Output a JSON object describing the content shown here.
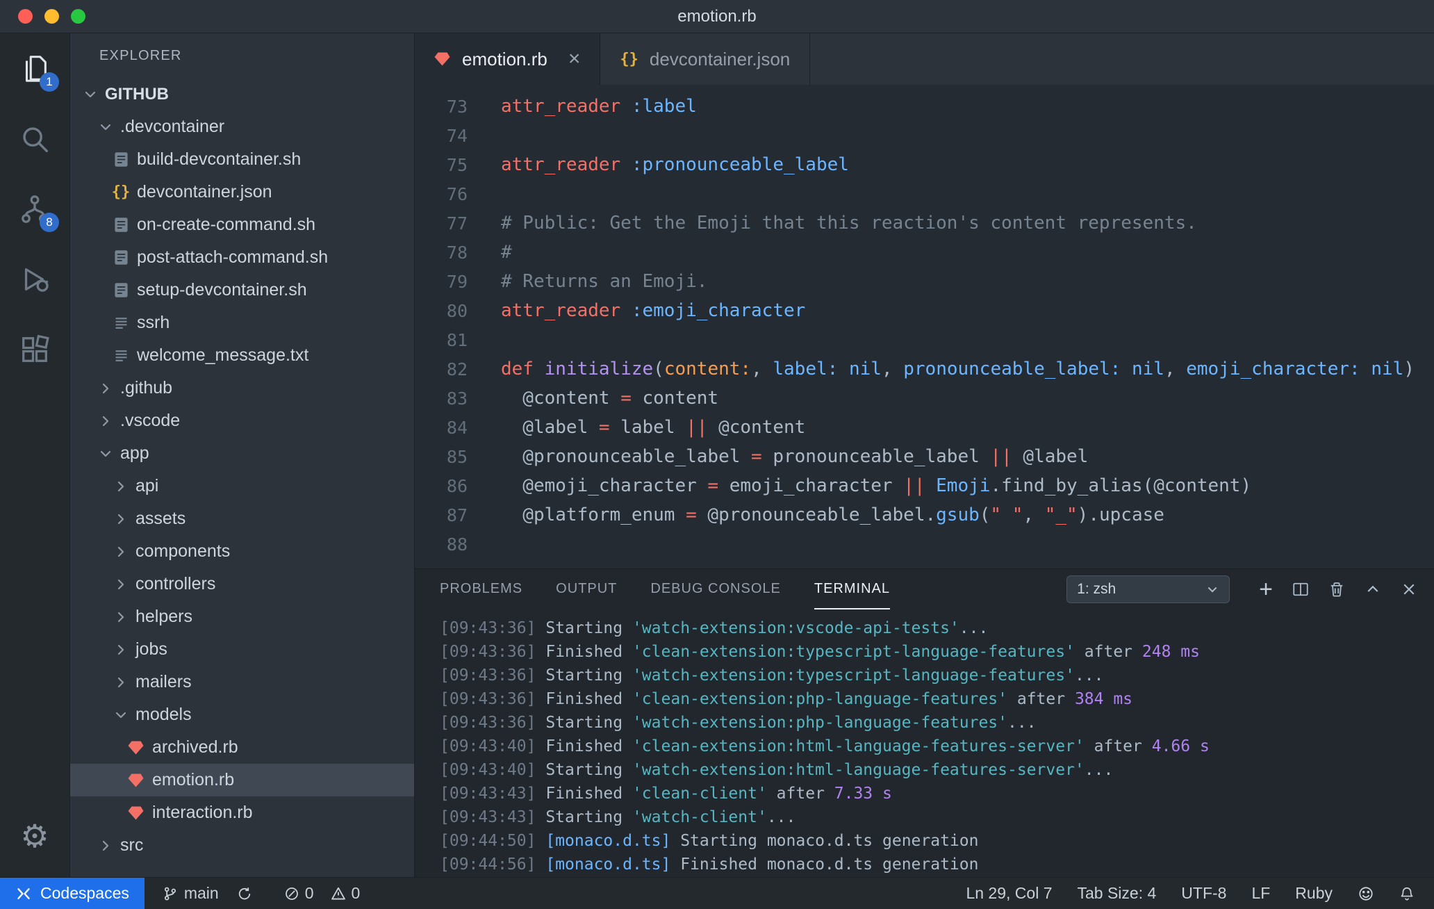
{
  "window": {
    "title": "emotion.rb"
  },
  "activity_bar": {
    "explorer_badge": "1",
    "scm_badge": "8"
  },
  "sidebar": {
    "header": "EXPLORER",
    "tree": [
      {
        "label": "GITHUB",
        "type": "root",
        "level": 0,
        "expanded": true
      },
      {
        "label": ".devcontainer",
        "type": "folder",
        "level": 1,
        "expanded": true
      },
      {
        "label": "build-devcontainer.sh",
        "type": "file",
        "icon": "sh",
        "level": 2
      },
      {
        "label": "devcontainer.json",
        "type": "file",
        "icon": "json",
        "level": 2
      },
      {
        "label": "on-create-command.sh",
        "type": "file",
        "icon": "sh",
        "level": 2
      },
      {
        "label": "post-attach-command.sh",
        "type": "file",
        "icon": "sh",
        "level": 2
      },
      {
        "label": "setup-devcontainer.sh",
        "type": "file",
        "icon": "sh",
        "level": 2
      },
      {
        "label": "ssrh",
        "type": "file",
        "icon": "txt",
        "level": 2
      },
      {
        "label": "welcome_message.txt",
        "type": "file",
        "icon": "txt",
        "level": 2
      },
      {
        "label": ".github",
        "type": "folder",
        "level": 1,
        "expanded": false
      },
      {
        "label": ".vscode",
        "type": "folder",
        "level": 1,
        "expanded": false
      },
      {
        "label": "app",
        "type": "folder",
        "level": 1,
        "expanded": true
      },
      {
        "label": "api",
        "type": "folder",
        "level": 2,
        "expanded": false
      },
      {
        "label": "assets",
        "type": "folder",
        "level": 2,
        "expanded": false
      },
      {
        "label": "components",
        "type": "folder",
        "level": 2,
        "expanded": false
      },
      {
        "label": "controllers",
        "type": "folder",
        "level": 2,
        "expanded": false
      },
      {
        "label": "helpers",
        "type": "folder",
        "level": 2,
        "expanded": false
      },
      {
        "label": "jobs",
        "type": "folder",
        "level": 2,
        "expanded": false
      },
      {
        "label": "mailers",
        "type": "folder",
        "level": 2,
        "expanded": false
      },
      {
        "label": "models",
        "type": "folder",
        "level": 2,
        "expanded": true
      },
      {
        "label": "archived.rb",
        "type": "file",
        "icon": "ruby",
        "level": 3
      },
      {
        "label": "emotion.rb",
        "type": "file",
        "icon": "ruby",
        "level": 3,
        "selected": true
      },
      {
        "label": "interaction.rb",
        "type": "file",
        "icon": "ruby",
        "level": 3
      },
      {
        "label": "src",
        "type": "folder",
        "level": 1,
        "expanded": false
      }
    ]
  },
  "editor_tabs": [
    {
      "label": "emotion.rb",
      "icon": "ruby",
      "active": true
    },
    {
      "label": "devcontainer.json",
      "icon": "json",
      "active": false
    }
  ],
  "editor": {
    "lines": [
      {
        "n": "73",
        "tokens": [
          [
            "attr_reader",
            "r"
          ],
          [
            " ",
            "f"
          ],
          [
            ":label",
            "b"
          ]
        ]
      },
      {
        "n": "74",
        "tokens": []
      },
      {
        "n": "75",
        "tokens": [
          [
            "attr_reader",
            "r"
          ],
          [
            " ",
            "f"
          ],
          [
            ":pronounceable_label",
            "b"
          ]
        ]
      },
      {
        "n": "76",
        "tokens": []
      },
      {
        "n": "77",
        "tokens": [
          [
            "# Public: Get the Emoji that this reaction's content represents.",
            "g"
          ]
        ]
      },
      {
        "n": "78",
        "tokens": [
          [
            "#",
            "g"
          ]
        ]
      },
      {
        "n": "79",
        "tokens": [
          [
            "# Returns an Emoji.",
            "g"
          ]
        ]
      },
      {
        "n": "80",
        "tokens": [
          [
            "attr_reader",
            "r"
          ],
          [
            " ",
            "f"
          ],
          [
            ":emoji_character",
            "b"
          ]
        ]
      },
      {
        "n": "81",
        "tokens": []
      },
      {
        "n": "82",
        "tokens": [
          [
            "def",
            "r"
          ],
          [
            " ",
            "f"
          ],
          [
            "initialize",
            "p"
          ],
          [
            "(",
            "f"
          ],
          [
            "content:",
            "o"
          ],
          [
            ", ",
            "f"
          ],
          [
            "label:",
            "b"
          ],
          [
            " ",
            "f"
          ],
          [
            "nil",
            "b"
          ],
          [
            ", ",
            "f"
          ],
          [
            "pronounceable_label:",
            "b"
          ],
          [
            " ",
            "f"
          ],
          [
            "nil",
            "b"
          ],
          [
            ", ",
            "f"
          ],
          [
            "emoji_character:",
            "b"
          ],
          [
            " ",
            "f"
          ],
          [
            "nil",
            "b"
          ],
          [
            ")",
            "f"
          ]
        ]
      },
      {
        "n": "83",
        "tokens": [
          [
            "  @content ",
            "f"
          ],
          [
            "=",
            "r"
          ],
          [
            " content",
            "f"
          ]
        ]
      },
      {
        "n": "84",
        "tokens": [
          [
            "  @label ",
            "f"
          ],
          [
            "=",
            "r"
          ],
          [
            " label ",
            "f"
          ],
          [
            "||",
            "r"
          ],
          [
            " @content",
            "f"
          ]
        ]
      },
      {
        "n": "85",
        "tokens": [
          [
            "  @pronounceable_label ",
            "f"
          ],
          [
            "=",
            "r"
          ],
          [
            " pronounceable_label ",
            "f"
          ],
          [
            "||",
            "r"
          ],
          [
            " @label",
            "f"
          ]
        ]
      },
      {
        "n": "86",
        "tokens": [
          [
            "  @emoji_character ",
            "f"
          ],
          [
            "=",
            "r"
          ],
          [
            " emoji_character ",
            "f"
          ],
          [
            "||",
            "r"
          ],
          [
            " ",
            "f"
          ],
          [
            "Emoji",
            "b"
          ],
          [
            ".find_by_alias(@content)",
            "f"
          ]
        ]
      },
      {
        "n": "87",
        "tokens": [
          [
            "  @platform_enum ",
            "f"
          ],
          [
            "=",
            "r"
          ],
          [
            " @pronounceable_label.",
            "f"
          ],
          [
            "gsub",
            "b"
          ],
          [
            "(",
            "f"
          ],
          [
            "\" \"",
            "r"
          ],
          [
            ", ",
            "f"
          ],
          [
            "\"_\"",
            "r"
          ],
          [
            ").upcase",
            "f"
          ]
        ]
      },
      {
        "n": "88",
        "tokens": []
      }
    ]
  },
  "panel": {
    "tabs": [
      {
        "label": "PROBLEMS",
        "active": false
      },
      {
        "label": "OUTPUT",
        "active": false
      },
      {
        "label": "DEBUG CONSOLE",
        "active": false
      },
      {
        "label": "TERMINAL",
        "active": true
      }
    ],
    "shell_select": "1: zsh",
    "terminal_lines": [
      [
        [
          "[09:43:36] ",
          "t"
        ],
        [
          "Starting ",
          "f"
        ],
        [
          "'watch-extension:vscode-api-tests'",
          "c"
        ],
        [
          "...",
          "f"
        ]
      ],
      [
        [
          "[09:43:36] ",
          "t"
        ],
        [
          "Finished ",
          "f"
        ],
        [
          "'clean-extension:typescript-language-features'",
          "c"
        ],
        [
          " after ",
          "f"
        ],
        [
          "248 ms",
          "m"
        ]
      ],
      [
        [
          "[09:43:36] ",
          "t"
        ],
        [
          "Starting ",
          "f"
        ],
        [
          "'watch-extension:typescript-language-features'",
          "c"
        ],
        [
          "...",
          "f"
        ]
      ],
      [
        [
          "[09:43:36] ",
          "t"
        ],
        [
          "Finished ",
          "f"
        ],
        [
          "'clean-extension:php-language-features'",
          "c"
        ],
        [
          " after ",
          "f"
        ],
        [
          "384 ms",
          "m"
        ]
      ],
      [
        [
          "[09:43:36] ",
          "t"
        ],
        [
          "Starting ",
          "f"
        ],
        [
          "'watch-extension:php-language-features'",
          "c"
        ],
        [
          "...",
          "f"
        ]
      ],
      [
        [
          "[09:43:40] ",
          "t"
        ],
        [
          "Finished ",
          "f"
        ],
        [
          "'clean-extension:html-language-features-server'",
          "c"
        ],
        [
          " after ",
          "f"
        ],
        [
          "4.66 s",
          "m"
        ]
      ],
      [
        [
          "[09:43:40] ",
          "t"
        ],
        [
          "Starting ",
          "f"
        ],
        [
          "'watch-extension:html-language-features-server'",
          "c"
        ],
        [
          "...",
          "f"
        ]
      ],
      [
        [
          "[09:43:43] ",
          "t"
        ],
        [
          "Finished ",
          "f"
        ],
        [
          "'clean-client'",
          "c"
        ],
        [
          " after ",
          "f"
        ],
        [
          "7.33 s",
          "m"
        ]
      ],
      [
        [
          "[09:43:43] ",
          "t"
        ],
        [
          "Starting ",
          "f"
        ],
        [
          "'watch-client'",
          "c"
        ],
        [
          "...",
          "f"
        ]
      ],
      [
        [
          "[09:44:50] ",
          "t"
        ],
        [
          "[monaco.d.ts] ",
          "b"
        ],
        [
          "Starting monaco.d.ts generation",
          "f"
        ]
      ],
      [
        [
          "[09:44:56] ",
          "t"
        ],
        [
          "[monaco.d.ts] ",
          "b"
        ],
        [
          "Finished monaco.d.ts generation",
          "f"
        ]
      ]
    ]
  },
  "status_bar": {
    "codespaces": "Codespaces",
    "branch": "main",
    "errors": "0",
    "warnings": "0",
    "line_col": "Ln 29, Col 7",
    "tab_size": "Tab Size: 4",
    "encoding": "UTF-8",
    "eol": "LF",
    "language": "Ruby"
  },
  "colors": {
    "codespaces_blue": "#1f6feb",
    "badge_blue": "#316dca",
    "ruby_red": "#f47067",
    "json_yellow": "#e3b341",
    "keyword_red": "#f47067",
    "symbol_blue": "#6cb6ff",
    "comment_gray": "#768390"
  }
}
